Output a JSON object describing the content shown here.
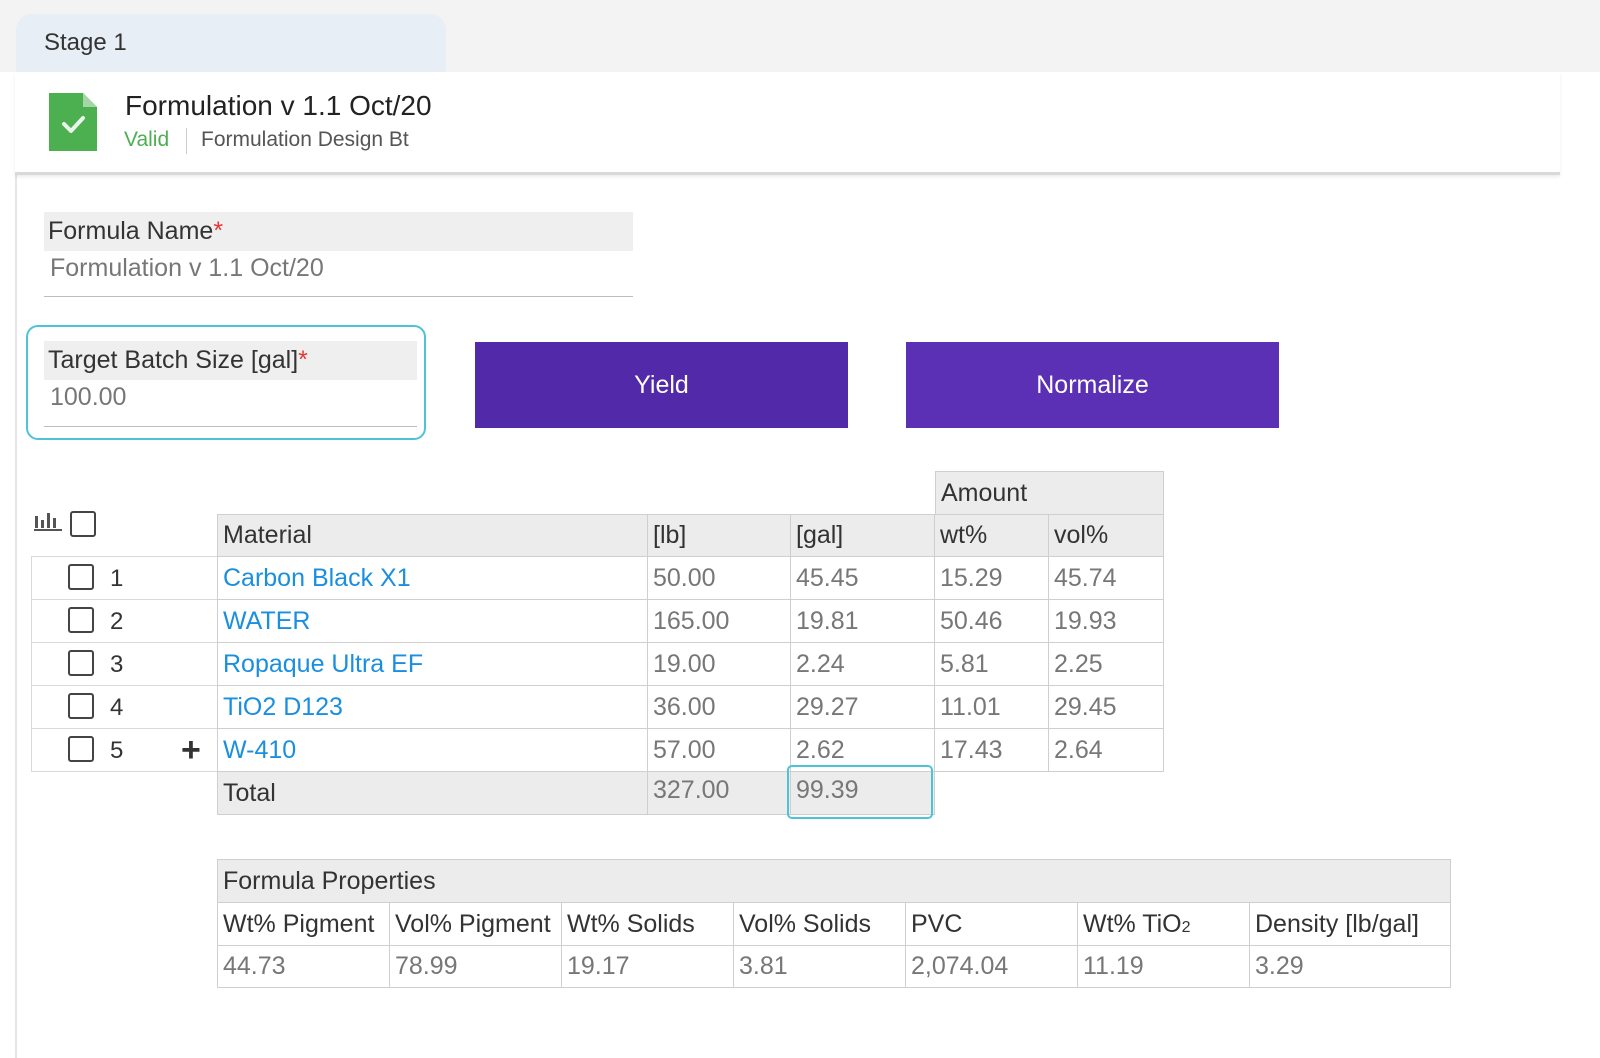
{
  "stage": {
    "tab_label": "Stage 1"
  },
  "header": {
    "title": "Formulation v 1.1 Oct/20",
    "status": "Valid",
    "subtitle": "Formulation Design Bt",
    "icon": "document-check-icon"
  },
  "form": {
    "formula_name": {
      "label": "Formula Name",
      "required_mark": "*",
      "value": "Formulation v 1.1 Oct/20"
    },
    "target_batch": {
      "label": "Target Batch Size [gal]",
      "required_mark": "*",
      "value": "100.00"
    }
  },
  "buttons": {
    "yield": "Yield",
    "normalize": "Normalize"
  },
  "materials_table": {
    "group_header": "Amount",
    "columns": [
      "Material",
      "[lb]",
      "[gal]",
      "wt%",
      "vol%"
    ],
    "rows": [
      {
        "num": "1",
        "material": "Carbon Black X1",
        "lb": "50.00",
        "gal": "45.45",
        "wt": "15.29",
        "vol": "45.74"
      },
      {
        "num": "2",
        "material": "WATER",
        "lb": "165.00",
        "gal": "19.81",
        "wt": "50.46",
        "vol": "19.93"
      },
      {
        "num": "3",
        "material": "Ropaque Ultra EF",
        "lb": "19.00",
        "gal": "2.24",
        "wt": "5.81",
        "vol": "2.25"
      },
      {
        "num": "4",
        "material": "TiO2 D123",
        "lb": "36.00",
        "gal": "29.27",
        "wt": "11.01",
        "vol": "29.45"
      },
      {
        "num": "5",
        "material": "W-410",
        "lb": "57.00",
        "gal": "2.62",
        "wt": "17.43",
        "vol": "2.64"
      }
    ],
    "total": {
      "label": "Total",
      "lb": "327.00",
      "gal": "99.39"
    }
  },
  "properties_table": {
    "title": "Formula Properties",
    "columns": [
      "Wt% Pigment",
      "Vol% Pigment",
      "Wt% Solids",
      "Vol% Solids",
      "PVC",
      "Wt% TiO",
      "Density [lb/gal]"
    ],
    "tio2_subscript": "2",
    "values": [
      "44.73",
      "78.99",
      "19.17",
      "3.81",
      "2,074.04",
      "11.19",
      "3.29"
    ]
  },
  "colors": {
    "accent": "#5229a8",
    "link": "#1a8fe0",
    "valid": "#4caf50",
    "focus": "#4fc3d6"
  }
}
